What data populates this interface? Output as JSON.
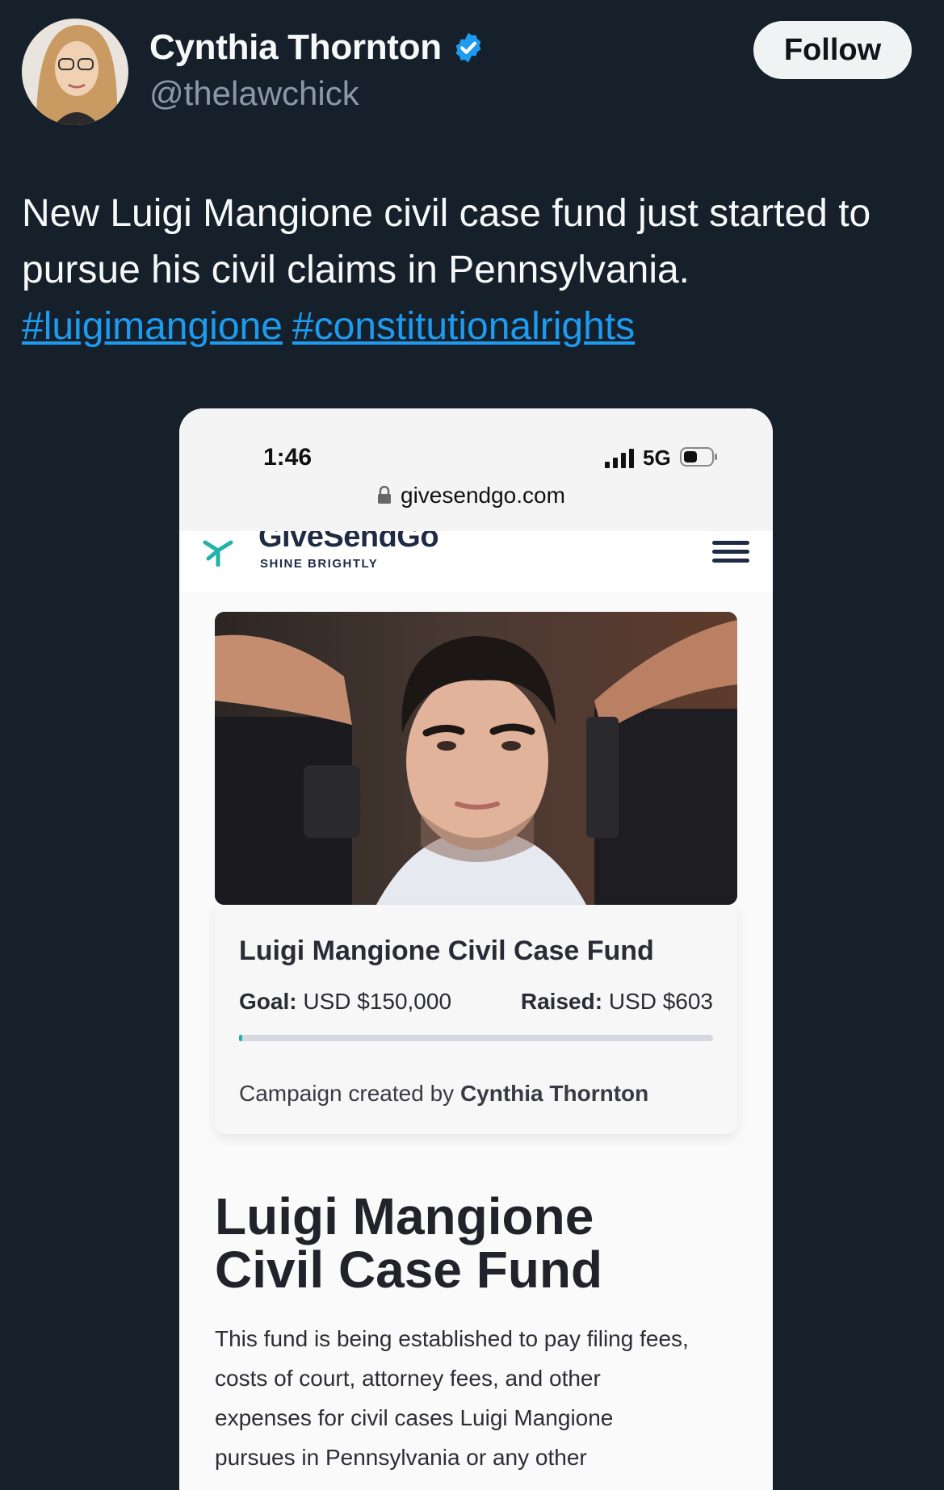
{
  "tweet": {
    "author": {
      "display_name": "Cynthia Thornton",
      "handle": "@thelawchick",
      "verified": true
    },
    "follow_label": "Follow",
    "text": "New Luigi Mangione civil case fund just started to pursue his civil claims in Pennsylvania.",
    "hashtags": [
      "#luigimangione",
      "#constitutionalrights"
    ]
  },
  "phone": {
    "status_time": "1:46",
    "network": "5G",
    "url": "givesendgo.com"
  },
  "site": {
    "logo_text": "GiveSendGo",
    "tagline": "SHINE BRIGHTLY"
  },
  "campaign": {
    "card_title": "Luigi Mangione Civil Case Fund",
    "goal_label": "Goal:",
    "goal_value": "USD $150,000",
    "raised_label": "Raised:",
    "raised_value": "USD $603",
    "progress_fraction": 0.004,
    "creator_prefix": "Campaign created by",
    "creator_name": "Cynthia Thornton",
    "title": "Luigi Mangione Civil Case Fund",
    "description": "This fund is being established to pay filing fees, costs of court, attorney fees, and other expenses for civil cases Luigi Mangione pursues in Pennsylvania or any other"
  },
  "colors": {
    "background": "#15202b",
    "hashtag": "#1d9bf0",
    "verified": "#1d9bf0",
    "brand_teal": "#22b3a8"
  }
}
